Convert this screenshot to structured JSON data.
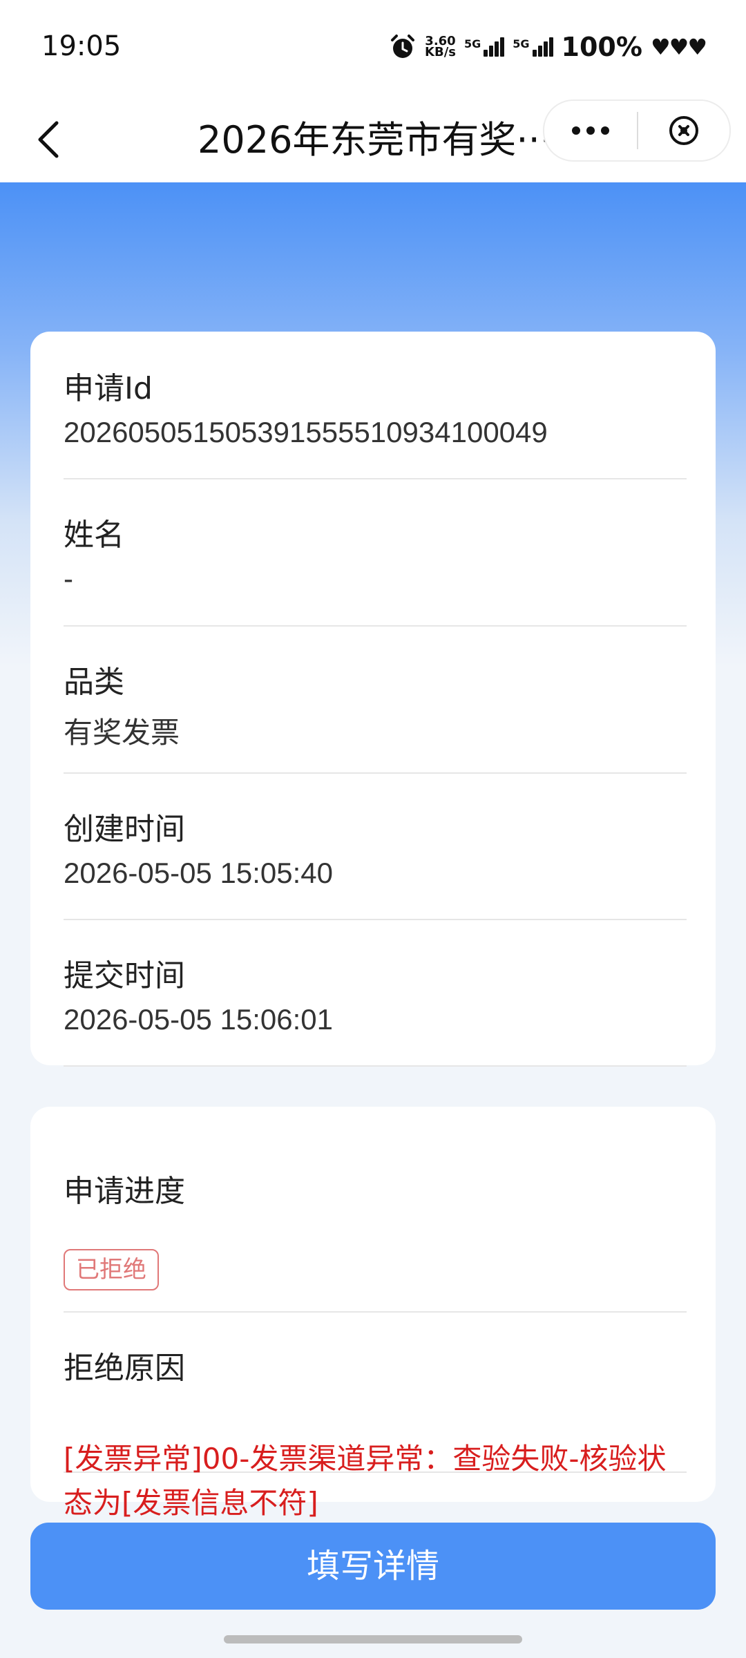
{
  "status_bar": {
    "time": "19:05",
    "net_speed_value": "3.60",
    "net_speed_unit": "KB/s",
    "sim1_label": "5G",
    "sim2_label": "5G",
    "battery": "100%",
    "icons": [
      "alarm-icon",
      "signal-icon",
      "signal-icon",
      "heart-icon"
    ]
  },
  "nav": {
    "title": "2026年东莞市有奖···",
    "back_icon": "chevron-left-icon",
    "more_icon": "more-dots-icon",
    "close_icon": "close-circle-icon"
  },
  "info_card": {
    "fields": [
      {
        "label": "申请Id",
        "value": "202605051505391555510934100049"
      },
      {
        "label": "姓名",
        "value": "-"
      },
      {
        "label": "品类",
        "value": "有奖发票"
      },
      {
        "label": "创建时间",
        "value": "2026-05-05 15:05:40"
      },
      {
        "label": "提交时间",
        "value": "2026-05-05 15:06:01"
      }
    ]
  },
  "status_card": {
    "progress_label": "申请进度",
    "progress_status": "已拒绝",
    "reason_label": "拒绝原因",
    "reason_text": "[发票异常]00-发票渠道异常：查验失败-核验状态为[发票信息不符]"
  },
  "actions": {
    "fill_details": "填写详情"
  },
  "colors": {
    "primary": "#4c91f6",
    "reject_red": "#d81e1e",
    "tag_red": "#e07878"
  }
}
